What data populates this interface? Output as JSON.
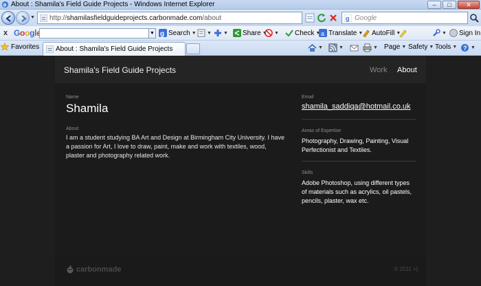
{
  "window": {
    "title": "About : Shamila's Field Guide Projects - Windows Internet Explorer",
    "minimize": "–",
    "maximize": "□",
    "close": "✕"
  },
  "address_bar": {
    "url_prefix": "http://",
    "url_host": "shamilasfieldguideprojects.carbonmade.com",
    "url_path": "/about",
    "search_placeholder": "Google"
  },
  "google_toolbar": {
    "close": "x",
    "logo": "Google",
    "search_label": "Search",
    "share_label": "Share",
    "check_label": "Check",
    "translate_label": "Translate",
    "autofill_label": "AutoFill",
    "signin_label": "Sign In"
  },
  "tabs_bar": {
    "favorites_label": "Favorites",
    "active_tab_title": "About : Shamila's Field Guide Projects",
    "page_label": "Page",
    "safety_label": "Safety",
    "tools_label": "Tools"
  },
  "site": {
    "title": "Shamila's Field Guide Projects",
    "nav": {
      "work": "Work",
      "about": "About"
    },
    "name_label": "Name",
    "name_value": "Shamila",
    "about_label": "About",
    "about_text": "I am a student studying BA Art and Design at Birmingham City University. I have a passion for Art, I love to draw, paint, make and work with textiles, wood, plaster and photography related work.",
    "email_label": "Email",
    "email_value": "shamila_saddiqa@hotmail.co.uk",
    "expertise_label": "Areas of Expertise",
    "expertise_value": "Photography, Drawing, Painting, Visual Perfectionist and Textiles.",
    "skills_label": "Skills",
    "skills_value": "Adobe Photoshop, using different types of materials such as acrylics, oil pastels, pencils, plaster, wax etc.",
    "footer_brand": "carbonmade",
    "footer_copyright": "© 2011 =]"
  },
  "colors": {
    "page_bg": "#1e1e1e",
    "header_bg": "#242424",
    "content_bg": "#1b1b1b",
    "label_gray": "#8e8e8e",
    "nav_inactive": "#888888",
    "ie_chrome": "#c9daf2"
  },
  "icons": [
    "ie-icon",
    "back-icon",
    "forward-icon",
    "refresh-icon",
    "stop-icon",
    "compat-icon",
    "google-icon",
    "favorites-star-icon",
    "home-icon",
    "feeds-icon",
    "mail-icon",
    "print-icon"
  ]
}
